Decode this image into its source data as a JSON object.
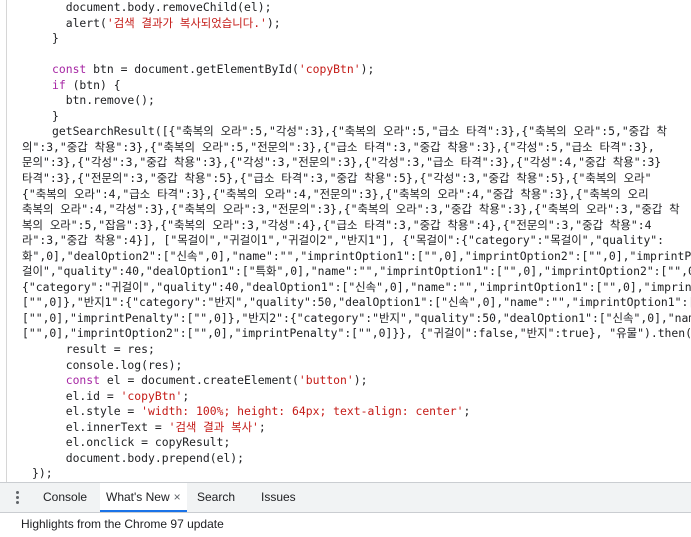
{
  "editor": {
    "lines": [
      "  document.body.removeChild(el);",
      "  alert('검색 결과가 복사되었습니다.');",
      "}",
      "",
      "const btn = document.getElementById('copyBtn');",
      "if (btn) {",
      "  btn.remove();",
      "}",
      "getSearchResult([{\"축복의 오라\":5,\"각성\":3},{\"축복의 오라\":5,\"급소 타격\":3},{\"축복의 오라\":5,\"중갑 착",
      "의\":3,\"중갑 착용\":3},{\"축복의 오라\":5,\"전문의\":3},{\"급소 타격\":3,\"중갑 착용\":3},{\"각성\":5,\"급소 타격\":3},",
      "문의\":3},{\"각성\":3,\"중갑 착용\":3},{\"각성\":3,\"전문의\":3},{\"각성\":3,\"급소 타격\":3},{\"각성\":4,\"중갑 착용\":3}",
      "타격\":3},{\"전문의\":3,\"중갑 착용\":5},{\"급소 타격\":3,\"중갑 착용\":5},{\"각성\":3,\"중갑 착용\":5},{\"축복의 오라\"",
      "{\"축복의 오라\":4,\"급소 타격\":3},{\"축복의 오라\":4,\"전문의\":3},{\"축복의 오라\":4,\"중갑 착용\":3},{\"축복의 오리",
      "축복의 오라\":4,\"각성\":3},{\"축복의 오라\":3,\"전문의\":3},{\"축복의 오라\":3,\"중갑 착용\":3},{\"축복의 오라\":3,\"중갑 착",
      "복의 오라\":5,\"잡음\":3},{\"축복의 오라\":3,\"각성\":4},{\"급소 타격\":3,\"중갑 착용\":4},{\"전문의\":3,\"중갑 착용\":4",
      "라\":3,\"중갑 착용\":4}], [\"목걸이\",\"귀걸이1\",\"귀걸이2\",\"반지1\"], {\"목걸이\":{\"category\":\"목걸이\",\"quality\":",
      "화\",0],\"dealOption2\":[\"신속\",0],\"name\":\"\",\"imprintOption1\":[\"\",0],\"imprintOption2\":[\"\",0],\"imprintPen",
      "걸이\",\"quality\":40,\"dealOption1\":[\"특화\",0],\"name\":\"\",\"imprintOption1\":[\"\",0],\"imprintOption2\":[\"\",0]",
      "{\"category\":\"귀걸이\",\"quality\":40,\"dealOption1\":[\"신속\",0],\"name\":\"\",\"imprintOption1\":[\"\",0],\"imprint",
      "[\"\",0]},\"반지1\":{\"category\":\"반지\",\"quality\":50,\"dealOption1\":[\"신속\",0],\"name\":\"\",\"imprintOption1\":[",
      "[\"\",0],\"imprintPenalty\":[\"\",0]},\"반지2\":{\"category\":\"반지\",\"quality\":50,\"dealOption1\":[\"신속\",0],\"name",
      "[\"\",0],\"imprintOption2\":[\"\",0],\"imprintPenalty\":[\"\",0]}}, {\"귀걸이\":false,\"반지\":true}, \"유물\").then(r",
      "  result = res;",
      "  console.log(res);",
      "  const el = document.createElement('button');",
      "  el.id = 'copyBtn';",
      "  el.style = 'width: 100%; height: 64px; text-align: center';",
      "  el.innerText = '검색 결과 복사';",
      "  el.onclick = copyResult;",
      "  document.body.prepend(el);",
      "});"
    ]
  },
  "drawer": {
    "tabs": [
      {
        "label": "Console",
        "active": false
      },
      {
        "label": "What's New",
        "active": true,
        "close": "×"
      },
      {
        "label": "Search",
        "active": false
      },
      {
        "label": "Issues",
        "active": false
      }
    ],
    "highlights_text": "Highlights from the Chrome 97 update"
  }
}
